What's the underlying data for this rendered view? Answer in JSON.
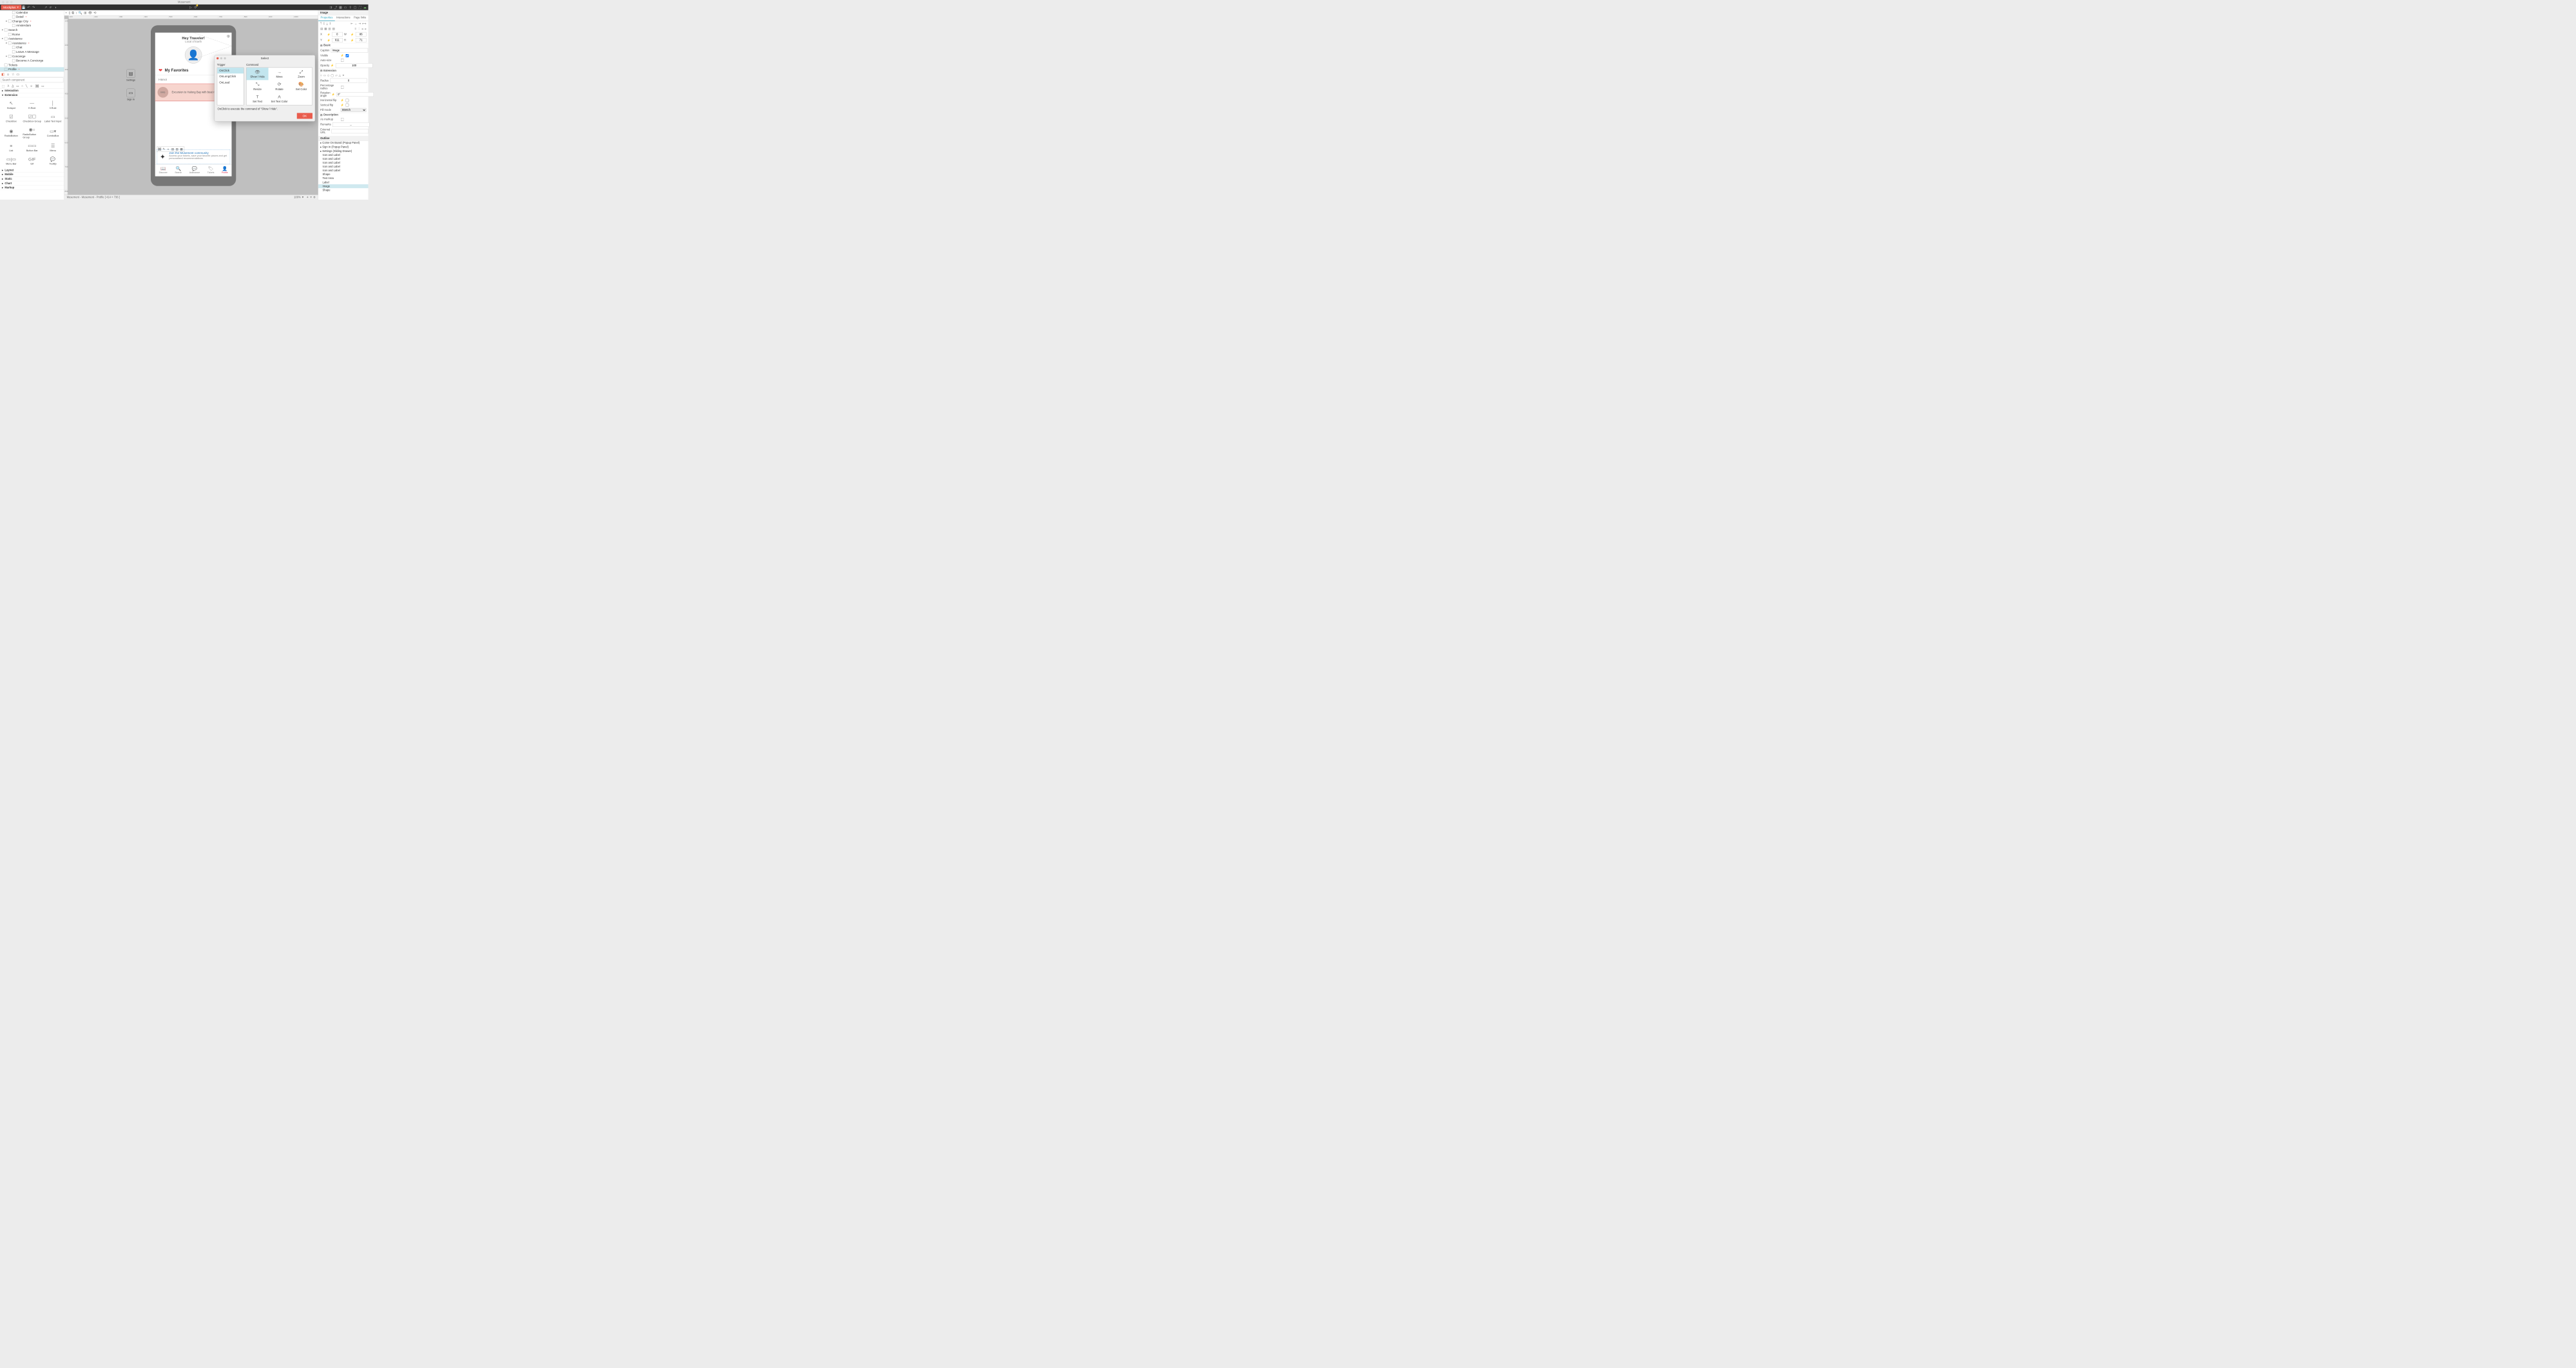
{
  "window": {
    "title": "Musement"
  },
  "brand": "Mockplus",
  "statusbar": {
    "left": "Musement - Musement - Profile [ 414 × 736 ]",
    "zoom": "100%"
  },
  "tree": {
    "items": [
      {
        "indent": 2,
        "label": "Calendar",
        "leaf": true
      },
      {
        "indent": 2,
        "label": "Detail",
        "leaf": true,
        "dot": true
      },
      {
        "indent": 1,
        "label": "Change City",
        "leaf": false,
        "dot": true
      },
      {
        "indent": 2,
        "label": "Amsterdam",
        "leaf": true
      },
      {
        "indent": 0,
        "label": "Search",
        "leaf": false
      },
      {
        "indent": 1,
        "label": "Rome",
        "leaf": true
      },
      {
        "indent": 0,
        "label": "Assistance",
        "leaf": false
      },
      {
        "indent": 1,
        "label": "Assistance",
        "leaf": false,
        "dot": true
      },
      {
        "indent": 2,
        "label": "Chat",
        "leaf": true
      },
      {
        "indent": 2,
        "label": "Leave A Message",
        "leaf": true
      },
      {
        "indent": 1,
        "label": "Concierge",
        "leaf": false
      },
      {
        "indent": 2,
        "label": "Become A Concierge",
        "leaf": true
      },
      {
        "indent": 0,
        "label": "Tickets",
        "leaf": true
      },
      {
        "indent": 0,
        "label": "Profile",
        "leaf": true,
        "dot": true,
        "selected": true
      }
    ]
  },
  "search_components_placeholder": "Search component",
  "categories": {
    "interaction": "Interaction",
    "extension": "Extension",
    "layout": "Layout",
    "mobile": "Mobile",
    "static": "Static",
    "chart": "Chart",
    "markup": "Markup"
  },
  "extension_components": [
    "Hotspot",
    "H.Rule",
    "V.Rule",
    "Checkbox",
    "Checkbox Group",
    "Label Text Input",
    "RadioButton",
    "RadioButton Group",
    "ComboBox",
    "List",
    "Button Bar",
    "Menu",
    "Menu Bar",
    "Gif",
    "Tooltip"
  ],
  "canvas": {
    "float1": "Settings",
    "float2": "Sign In",
    "header_title": "Hey Traveler!",
    "header_sub": "Local of Earth",
    "favorites_title": "My Favorites",
    "city": "Hanoi",
    "fav_img": "IMG",
    "fav_text": "Excursion to Halong Bay with boat rid",
    "community_title": "Join the Musement community",
    "community_sub": "Access your tickets, save your favorite places and get personalized recommendations.",
    "tabs": [
      "Discover",
      "Search",
      "Assistance",
      "Tickets",
      "Profile"
    ]
  },
  "dialog": {
    "title": "Select",
    "col1": "Trigger",
    "col2": "Command",
    "triggers": [
      "OnClick",
      "OnLongClick",
      "OnLoad"
    ],
    "trigger_selected": 0,
    "commands": [
      "Show / Hide",
      "Move",
      "Zoom",
      "Resize",
      "Rotate",
      "Set Color",
      "Set Text",
      "Set Text Color"
    ],
    "command_selected": 0,
    "message": "OnClick to execute the command of \"Show / Hide\".",
    "ok": "OK"
  },
  "inspector": {
    "title": "Image",
    "tabs": [
      "Properties",
      "Interactions",
      "Page links"
    ],
    "x_label": "X",
    "y_label": "Y",
    "w_label": "W",
    "h_label": "H",
    "x": "0",
    "y": "611",
    "w": "86",
    "h": "71",
    "sect_basic": "Basic",
    "caption_label": "Caption",
    "caption_value": "Image",
    "visible": "Visible",
    "autosize": "Auto-size",
    "opacity_label": "Opacity",
    "opacity_value": "100",
    "sect_ext": "Extension",
    "radius_label": "Radius",
    "radius_value": "0",
    "pct_radius": "Percentage radius",
    "rot_label": "Rotation angle",
    "rot_value": "0°",
    "hflip": "Horizontal flip",
    "vflip": "Vertical flip",
    "fill_label": "Fill mode",
    "fill_value": "Stretch",
    "sect_desc": "Description",
    "as_markup": "As markup",
    "remarks": "Remarks",
    "remarks_value": "...",
    "ext_url": "External URL",
    "outline_title": "Outline",
    "outline": [
      "Come On Board (Popup Panel)",
      "Sign In (Popup Panel)",
      "Settings (Sliding Drawer)",
      "Icon and Label",
      "Icon and Label",
      "Icon and Label",
      "Icon and Label",
      "Icon and Label",
      "Shape",
      "Text Area",
      "Label",
      "Image",
      "Shape"
    ],
    "outline_selected": 11
  },
  "ruler_h": [
    "100",
    "200",
    "300",
    "400",
    "500",
    "600",
    "700",
    "800",
    "900",
    "1000"
  ],
  "ruler_v": [
    "100",
    "200",
    "300",
    "400",
    "500",
    "600",
    "700",
    "800"
  ]
}
